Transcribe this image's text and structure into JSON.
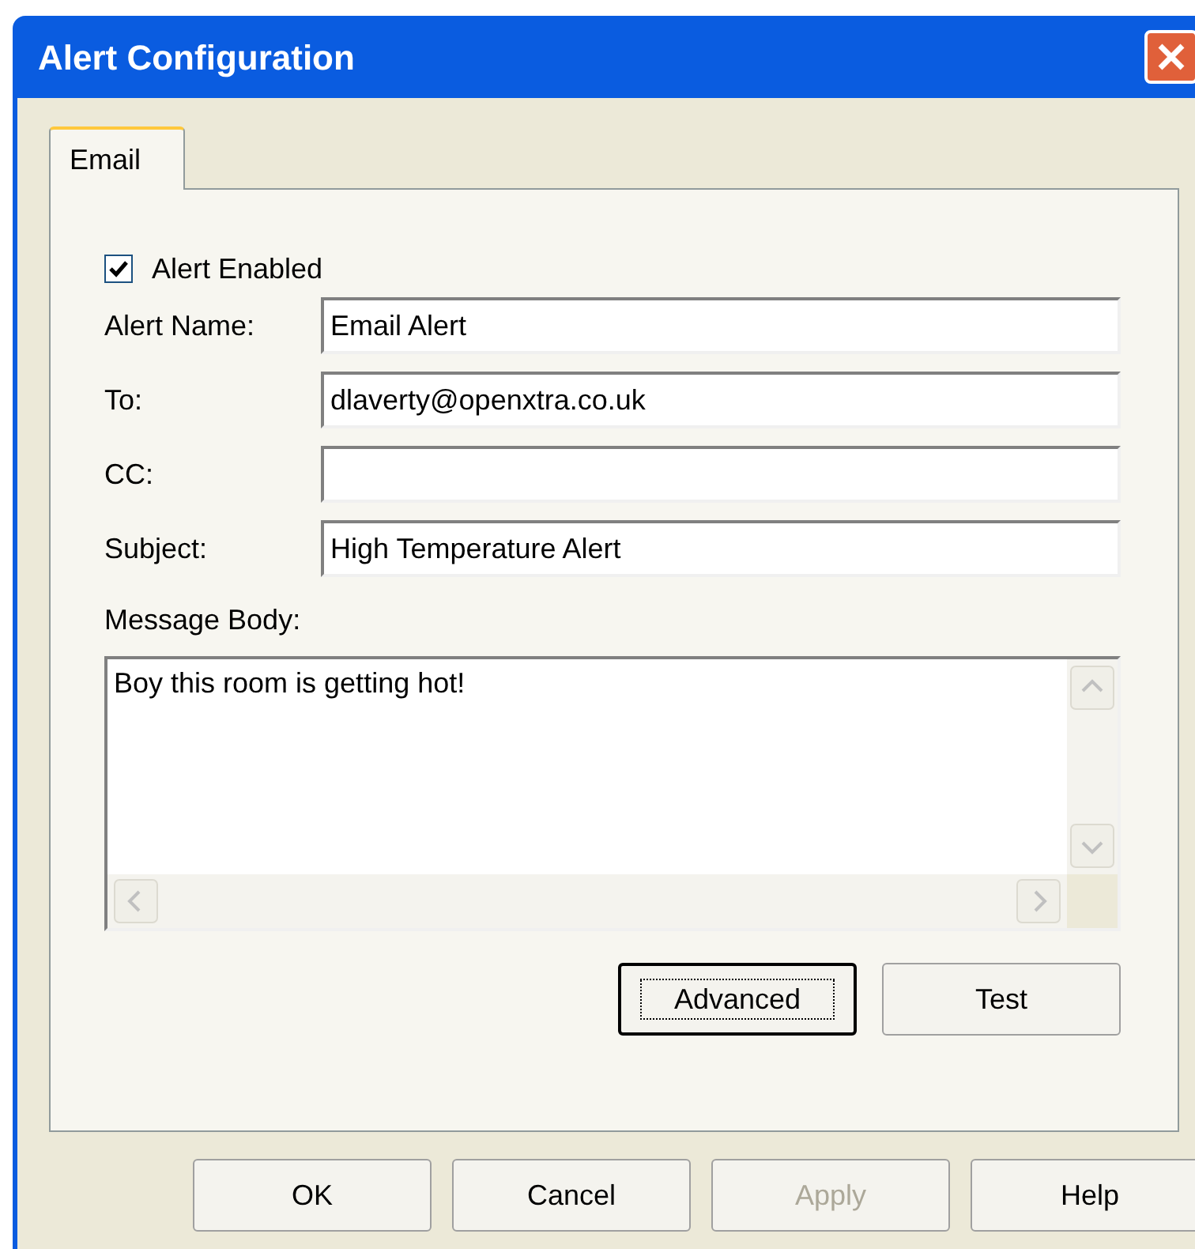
{
  "window": {
    "title": "Alert Configuration"
  },
  "tabs": [
    {
      "label": "Email",
      "selected": true
    }
  ],
  "alert_enabled": {
    "label": "Alert Enabled",
    "checked": true
  },
  "fields": [
    {
      "label": "Alert Name:",
      "value": "Email Alert"
    },
    {
      "label": "To:",
      "value": "dlaverty@openxtra.co.uk"
    },
    {
      "label": "CC:"
    },
    {
      "label": "Subject:",
      "value": "High Temperature Alert"
    }
  ],
  "message_body": {
    "label": "Message Body:",
    "value": "Boy this room is getting hot!"
  },
  "panel_buttons": [
    {
      "label": "Advanced",
      "focused": true
    },
    {
      "label": "Test",
      "focused": false
    }
  ],
  "dialog_buttons": [
    {
      "label": "OK",
      "disabled": false
    },
    {
      "label": "Cancel",
      "disabled": false
    },
    {
      "label": "Apply",
      "disabled": true
    },
    {
      "label": "Help",
      "disabled": false
    }
  ]
}
